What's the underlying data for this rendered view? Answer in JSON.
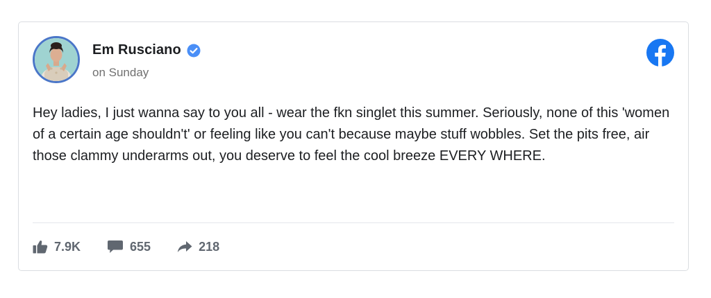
{
  "post": {
    "author": "Em Rusciano",
    "timestamp": "on Sunday",
    "text": "Hey ladies, I just wanna say to you all - wear the fkn singlet this summer. Seriously, none of this 'women of a certain age shouldn't' or feeling like you can't because maybe stuff wobbles. Set the pits free, air those clammy underarms out, you deserve to feel the cool breeze EVERY WHERE."
  },
  "stats": {
    "likes": "7.9K",
    "comments": "655",
    "shares": "218"
  },
  "icons": {
    "verified": "verified-badge-icon",
    "platform": "facebook-logo-icon",
    "like": "thumbs-up-icon",
    "comment": "speech-bubble-icon",
    "share": "share-arrow-icon"
  },
  "colors": {
    "facebook_blue": "#1877f2",
    "verified_blue": "#4a8ff7",
    "avatar_ring": "#4a76c8",
    "stat_gray": "#606770"
  }
}
